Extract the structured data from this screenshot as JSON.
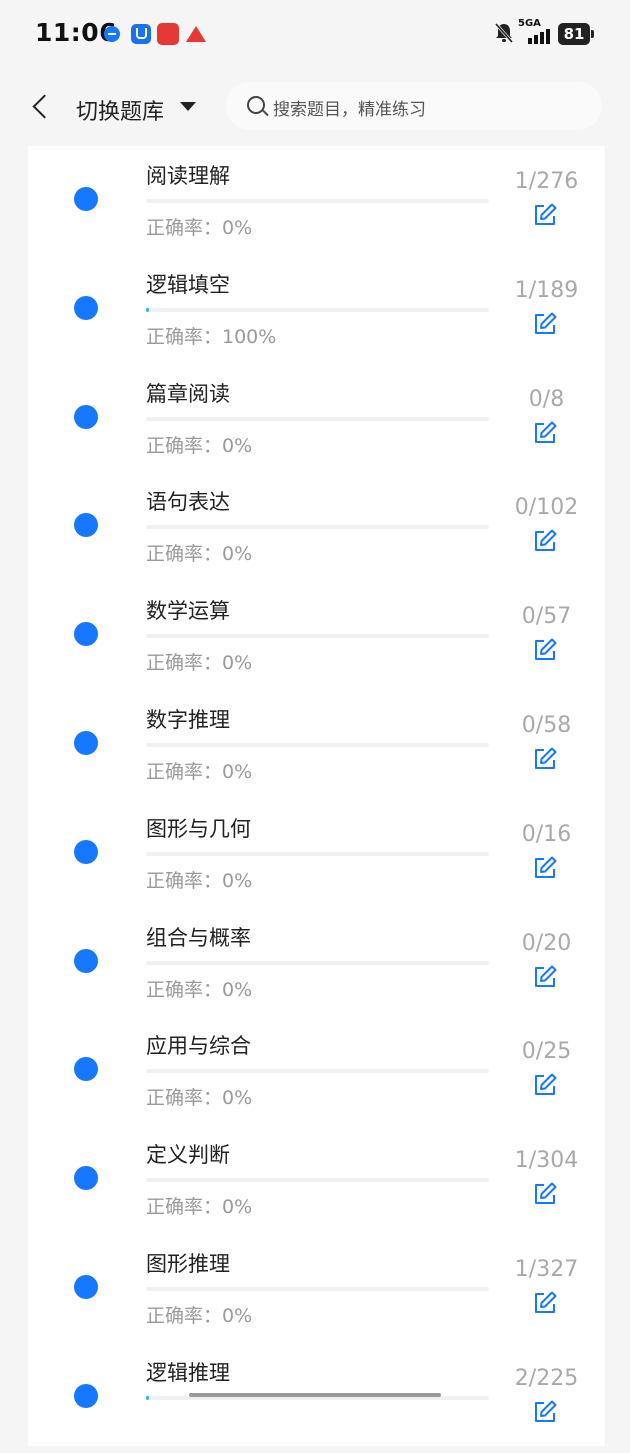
{
  "status_bar": {
    "time": "11:06",
    "signal_label": "5GA",
    "battery": "81",
    "app_icons": [
      "alipay-icon",
      "app-u-icon",
      "red-app-icon",
      "red-triangle-icon"
    ]
  },
  "nav": {
    "back_icon": "chevron-left-icon",
    "switch_label": "切换题库",
    "search_placeholder": "搜索题目，精准练习"
  },
  "colors": {
    "accent": "#1677ff",
    "progress": "#38b6e0",
    "muted_text": "#9a9a9a"
  },
  "items": [
    {
      "title": "阅读理解",
      "accuracy": "正确率：0%",
      "count": "1/276",
      "progress": 0
    },
    {
      "title": "逻辑填空",
      "accuracy": "正确率：100%",
      "count": "1/189",
      "progress": 0.0053
    },
    {
      "title": "篇章阅读",
      "accuracy": "正确率：0%",
      "count": "0/8",
      "progress": 0
    },
    {
      "title": "语句表达",
      "accuracy": "正确率：0%",
      "count": "0/102",
      "progress": 0
    },
    {
      "title": "数学运算",
      "accuracy": "正确率：0%",
      "count": "0/57",
      "progress": 0
    },
    {
      "title": "数字推理",
      "accuracy": "正确率：0%",
      "count": "0/58",
      "progress": 0
    },
    {
      "title": "图形与几何",
      "accuracy": "正确率：0%",
      "count": "0/16",
      "progress": 0
    },
    {
      "title": "组合与概率",
      "accuracy": "正确率：0%",
      "count": "0/20",
      "progress": 0
    },
    {
      "title": "应用与综合",
      "accuracy": "正确率：0%",
      "count": "0/25",
      "progress": 0
    },
    {
      "title": "定义判断",
      "accuracy": "正确率：0%",
      "count": "1/304",
      "progress": 0
    },
    {
      "title": "图形推理",
      "accuracy": "正确率：0%",
      "count": "1/327",
      "progress": 0
    },
    {
      "title": "逻辑推理",
      "accuracy": "",
      "count": "2/225",
      "progress": 0.0089
    }
  ]
}
